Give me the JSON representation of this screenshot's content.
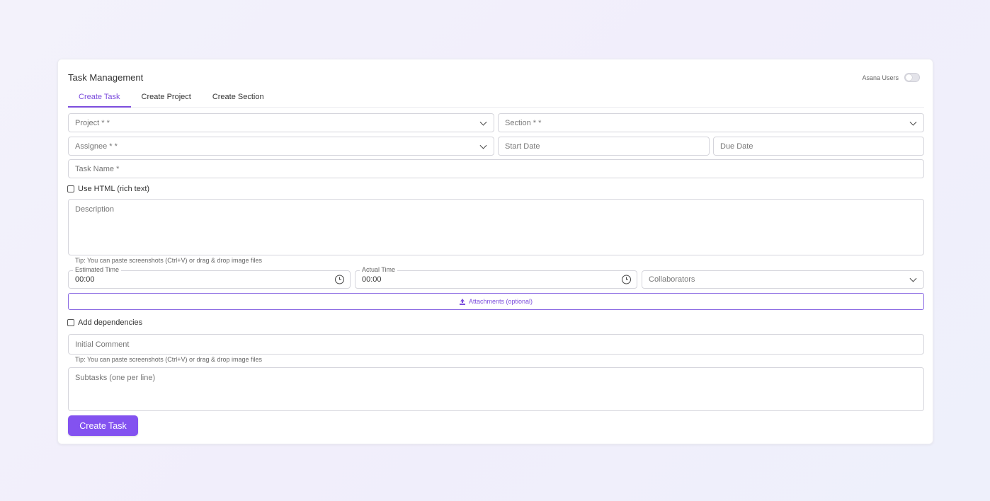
{
  "header": {
    "title": "Task Management",
    "toggle_label": "Asana Users"
  },
  "tabs": [
    {
      "label": "Create Task"
    },
    {
      "label": "Create Project"
    },
    {
      "label": "Create Section"
    }
  ],
  "form": {
    "project_placeholder": "Project * *",
    "section_placeholder": "Section * *",
    "assignee_placeholder": "Assignee * *",
    "start_date_placeholder": "Start Date",
    "due_date_placeholder": "Due Date",
    "task_name_placeholder": "Task Name *",
    "use_html_label": "Use HTML (rich text)",
    "description_placeholder": "Description",
    "tip": "Tip: You can paste screenshots (Ctrl+V) or drag & drop image files",
    "estimated_time_label": "Estimated Time",
    "estimated_time_value": "00:00",
    "actual_time_label": "Actual Time",
    "actual_time_value": "00:00",
    "collaborators_placeholder": "Collaborators",
    "attachments_label": "Attachments (optional)",
    "add_dependencies_label": "Add dependencies",
    "initial_comment_placeholder": "Initial Comment",
    "subtasks_placeholder": "Subtasks (one per line)",
    "submit_label": "Create Task"
  },
  "colors": {
    "accent": "#7c4ddd",
    "button": "#8352f0"
  },
  "icons": [
    "chevron-down-icon",
    "clock-icon",
    "upload-icon"
  ]
}
